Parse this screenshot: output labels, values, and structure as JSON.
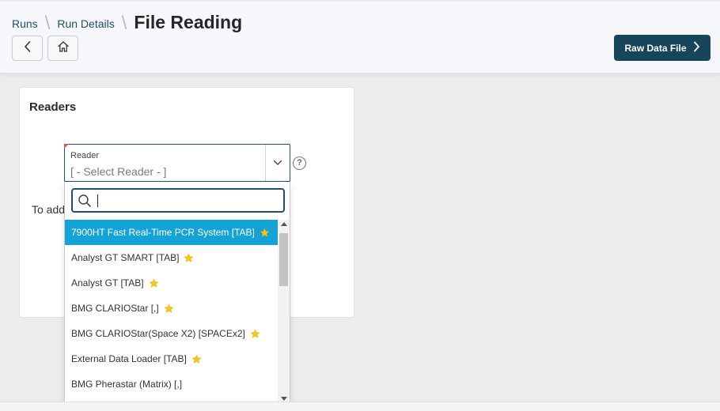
{
  "breadcrumb": {
    "items": [
      "Runs",
      "Run Details"
    ],
    "separator": "\\",
    "title": "File Reading"
  },
  "toolbar": {
    "back_icon": "chevron-left-icon",
    "home_icon": "home-icon",
    "raw_data_label": "Raw Data File",
    "raw_data_icon": "chevron-right-icon"
  },
  "readers": {
    "title": "Readers",
    "select": {
      "label": "Reader",
      "value": "[ - Select Reader - ]"
    },
    "help": "?",
    "info_text": "To add                                                                                    ection."
  },
  "dropdown": {
    "search_value": "",
    "options": [
      {
        "label": "7900HT Fast Real-Time PCR System [TAB]",
        "favorite": true,
        "selected": true
      },
      {
        "label": "Analyst GT SMART [TAB]",
        "favorite": true,
        "selected": false
      },
      {
        "label": "Analyst GT [TAB]",
        "favorite": true,
        "selected": false
      },
      {
        "label": "BMG CLARIOStar [,]",
        "favorite": true,
        "selected": false
      },
      {
        "label": "BMG CLARIOStar(Space X2) [SPACEx2]",
        "favorite": true,
        "selected": false
      },
      {
        "label": "External Data Loader [TAB]",
        "favorite": true,
        "selected": false
      },
      {
        "label": "BMG Pherastar (Matrix) [,]",
        "favorite": false,
        "selected": false
      }
    ]
  },
  "colors": {
    "primary": "#16455c",
    "link": "#1f4f6b",
    "selected": "#14a3d6",
    "star": "#f5c518",
    "required": "#d9534f"
  }
}
